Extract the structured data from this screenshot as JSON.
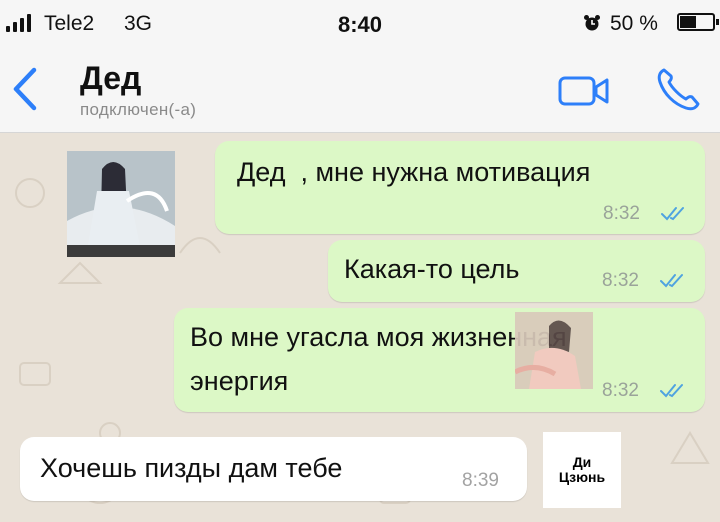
{
  "status_bar": {
    "carrier": "Tele2",
    "network": "3G",
    "time": "8:40",
    "battery": "50 %",
    "battery_level": 0.5
  },
  "header": {
    "contact_name": "Дед",
    "contact_status": "подключен(-а)",
    "icons": [
      "back-icon",
      "video-call-icon",
      "phone-call-icon"
    ]
  },
  "messages": [
    {
      "direction": "out",
      "text": "Дед  , мне нужна мотивация",
      "time": "8:32",
      "read": true
    },
    {
      "direction": "out",
      "text": "Какая-то цель",
      "time": "8:32",
      "read": true
    },
    {
      "direction": "out",
      "text_line1": "Во мне угасла моя жизненная",
      "text_line2": "энергия",
      "time": "8:32",
      "read": true
    },
    {
      "direction": "in",
      "text": "Хочешь пизды дам тебе",
      "time": "8:39"
    }
  ],
  "sticker": {
    "line1": "Ди",
    "line2": "Цзюнь"
  },
  "colors": {
    "outgoing_bubble": "#dcf8c6",
    "incoming_bubble": "#ffffff",
    "read_ticks": "#4fa3e0",
    "accent": "#2d7ff9"
  }
}
